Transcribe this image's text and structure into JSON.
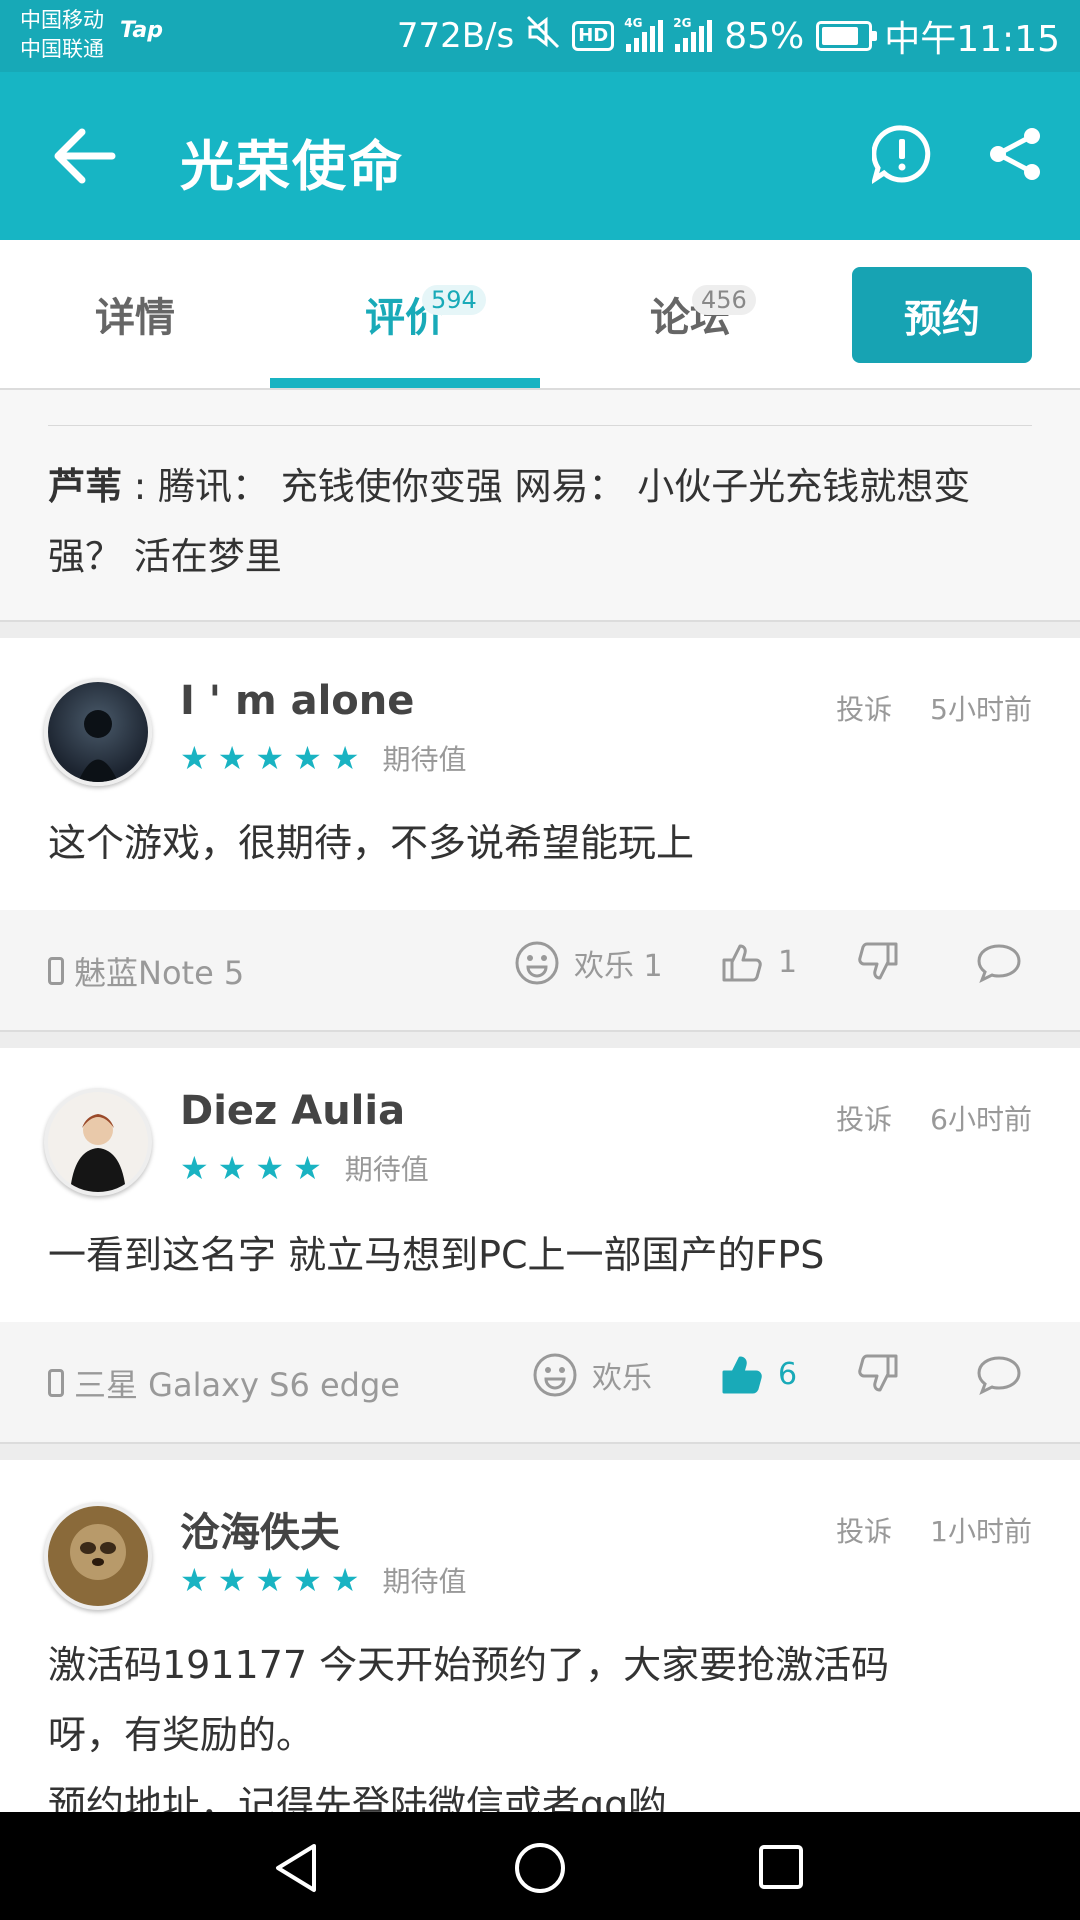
{
  "status_bar": {
    "carrier1": "中国移动",
    "carrier2": "中国联通",
    "tap_label": "Tap",
    "speed": "772B/s",
    "hd": "HD",
    "net1": "4G",
    "net2": "2G",
    "battery": "85%",
    "time": "中午11:15"
  },
  "header": {
    "title": "光荣使命",
    "back_icon": "arrow-left-icon",
    "report_icon": "exclamation-circle-icon",
    "share_icon": "share-icon"
  },
  "tabs": [
    {
      "label": "详情",
      "count": ""
    },
    {
      "label": "评价",
      "count": "594"
    },
    {
      "label": "论坛",
      "count": "456"
    }
  ],
  "reserve_label": "预约",
  "pinned": {
    "user": "芦苇",
    "text": " : 腾讯：  充钱使你变强 网易：  小伙子光充钱就想变强？ 活在梦里"
  },
  "reviews": [
    {
      "user": "I ' m alone",
      "report": "投诉",
      "time": "5小时前",
      "stars": 5,
      "star_label": "期待值",
      "content": "这个游戏，很期待，不多说希望能玩上",
      "device": "魅蓝Note 5",
      "fun_label": "欢乐 1",
      "like_count": "1"
    },
    {
      "user": "Diez Aulia",
      "report": "投诉",
      "time": "6小时前",
      "stars": 4,
      "star_label": "期待值",
      "content": "一看到这名字 就立马想到PC上一部国产的FPS",
      "device": "三星 Galaxy S6 edge",
      "fun_label": "欢乐",
      "like_count": "6"
    },
    {
      "user": "沧海佚夫",
      "report": "投诉",
      "time": "1小时前",
      "stars": 5,
      "star_label": "期待值",
      "content_line1": "激活码191177 今天开始预约了，大家要抢激活码",
      "content_line2": "呀，有奖励的。",
      "content_line3": "预约地址，记得先登陆微信或者qq哟"
    }
  ],
  "colors": {
    "accent": "#17b5c4",
    "accent_dark": "#17a3b3",
    "status_bar": "#17a9b7"
  }
}
